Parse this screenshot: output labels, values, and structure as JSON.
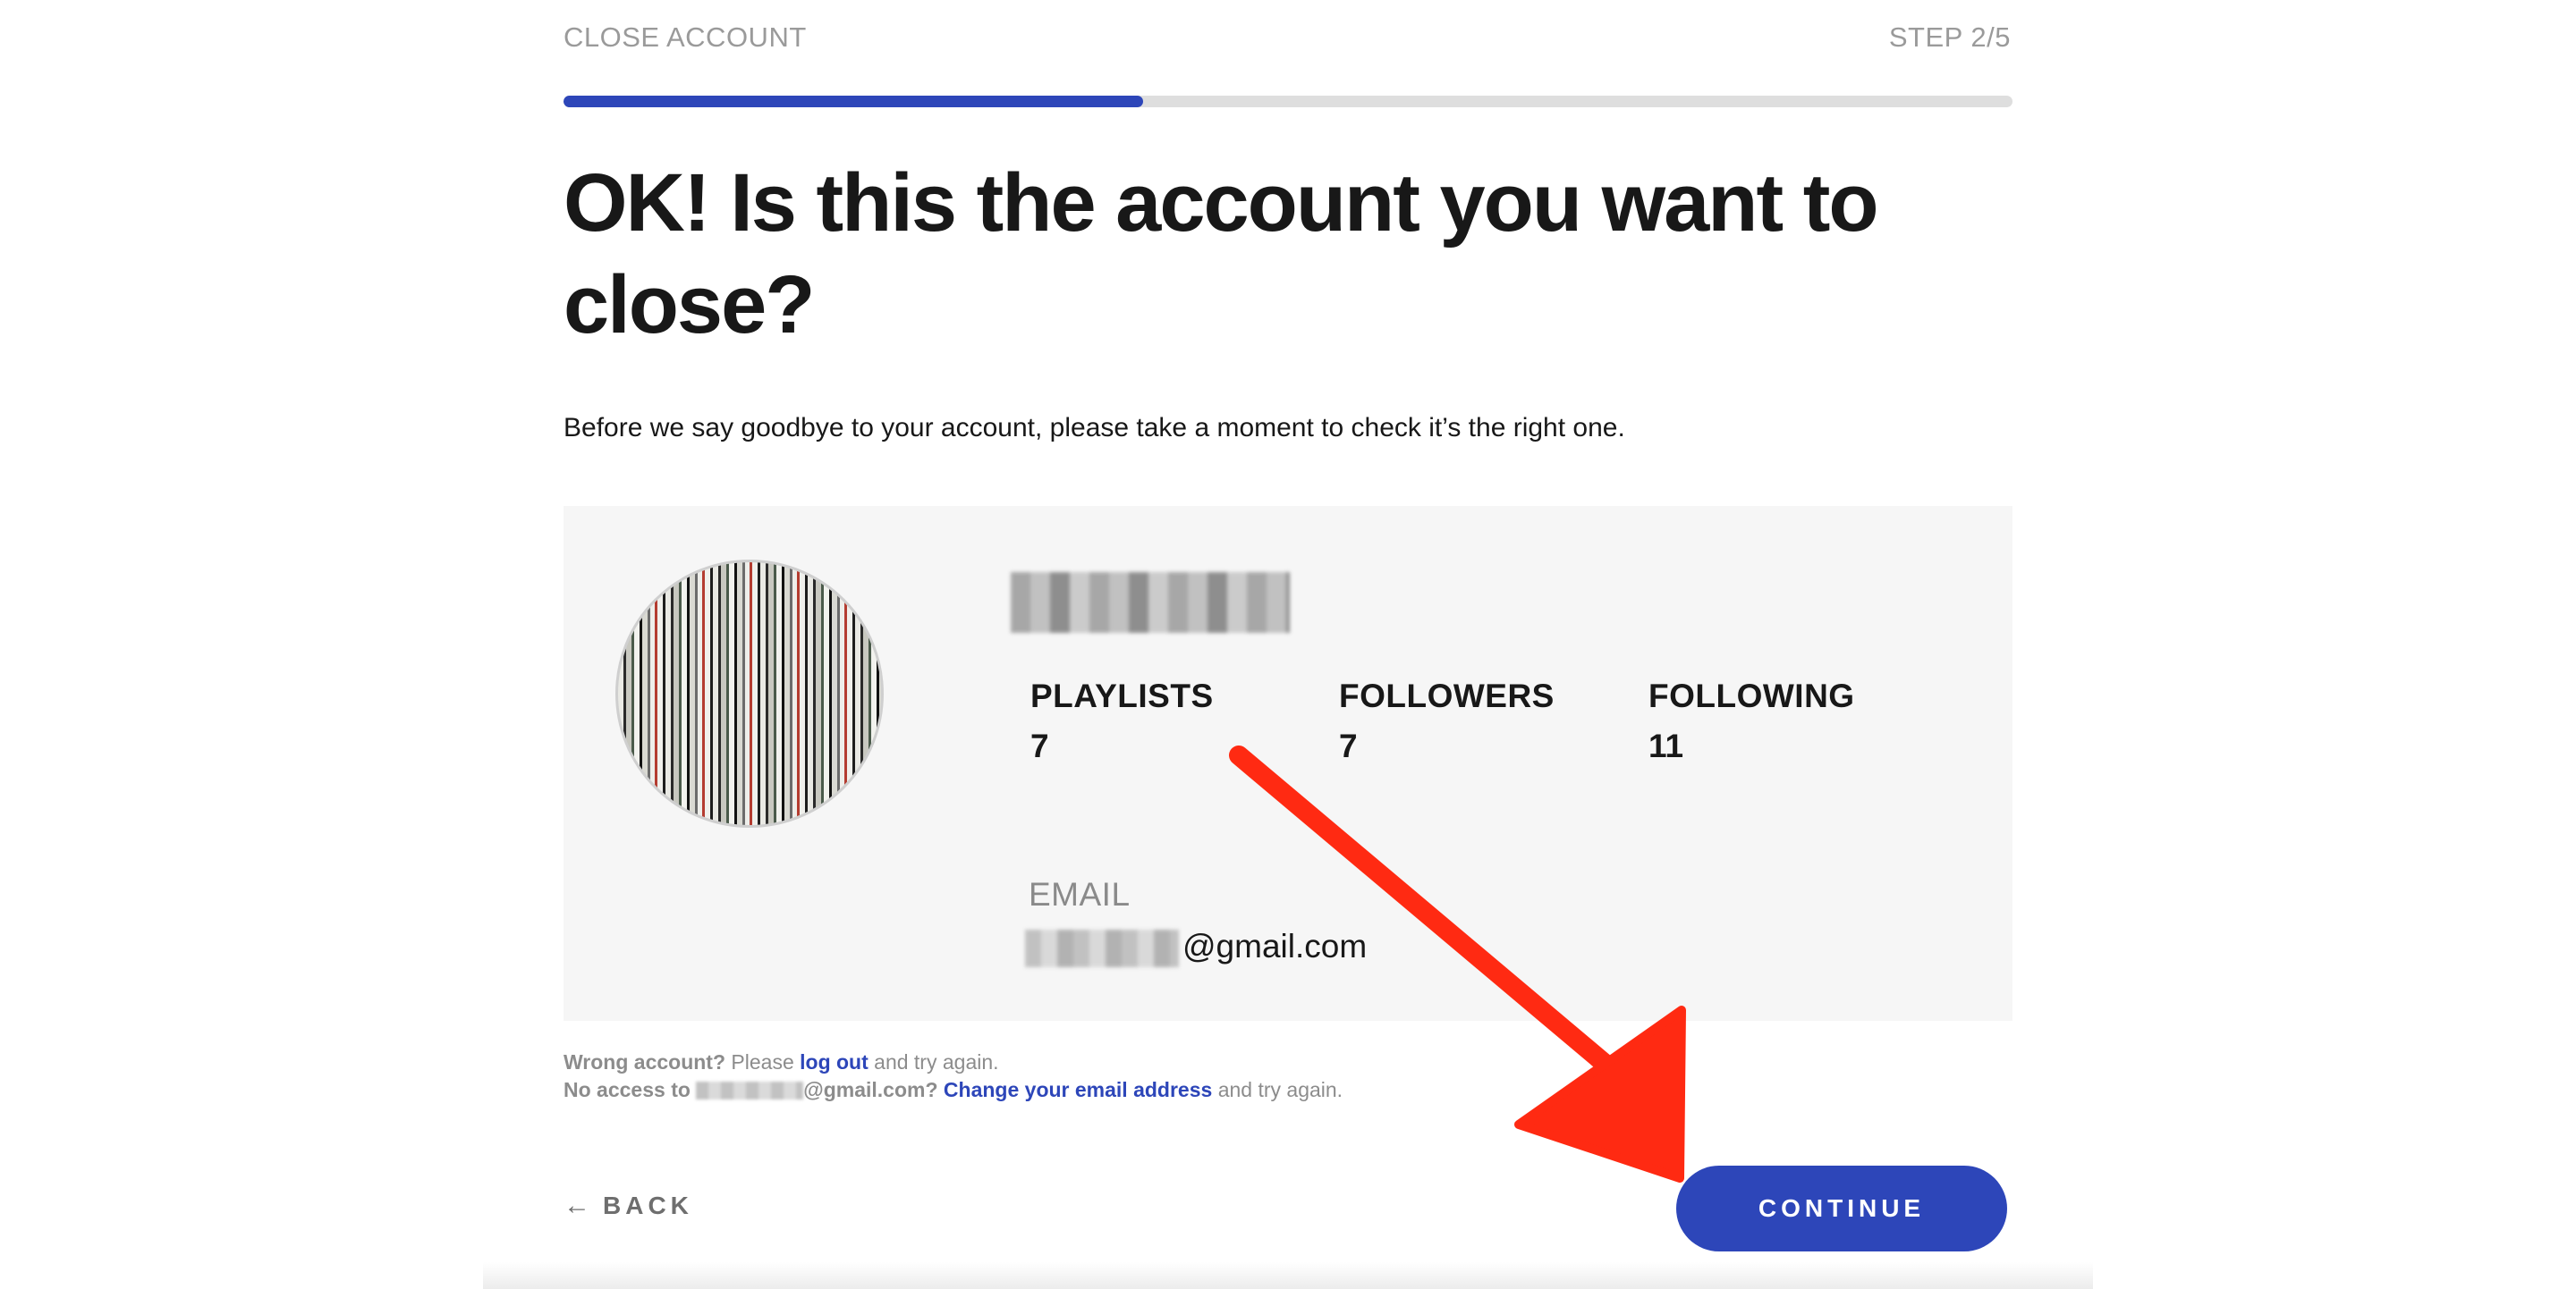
{
  "header": {
    "title": "CLOSE ACCOUNT",
    "step": "STEP 2/5",
    "progress": 0.4
  },
  "main": {
    "heading": "OK! Is this the account you want to close?",
    "intro": "Before we say goodbye to your account, please take a moment to check it’s the right one."
  },
  "account_card": {
    "stats": [
      {
        "label": "PLAYLISTS",
        "value": "7"
      },
      {
        "label": "FOLLOWERS",
        "value": "7"
      },
      {
        "label": "FOLLOWING",
        "value": "11"
      }
    ],
    "email_label": "EMAIL",
    "email_domain": "@gmail.com"
  },
  "help": {
    "line1_prefix": "Wrong account?",
    "line1_mid": " Please ",
    "line1_link": "log out",
    "line1_suffix": " and try again.",
    "line2_prefix": "No access to ",
    "line2_domain": "@gmail.com?",
    "line2_link": "Change your email address",
    "line2_suffix": " and try again."
  },
  "footer": {
    "back_icon": "←",
    "back_label": "BACK",
    "continue_label": "CONTINUE"
  },
  "colors": {
    "accent": "#2d46b9",
    "annotation_arrow": "#ff2a12"
  }
}
